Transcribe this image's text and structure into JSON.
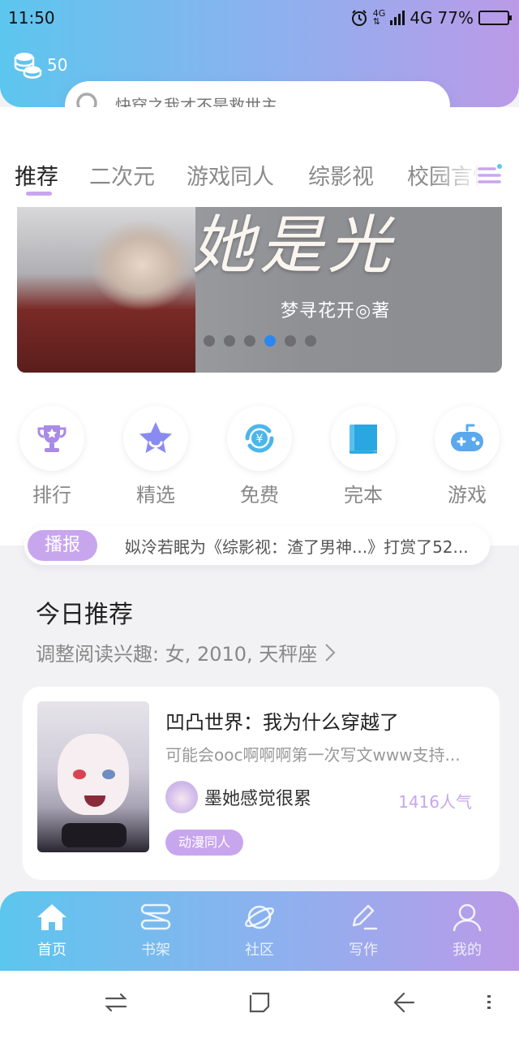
{
  "status_bar": {
    "time": "11:50",
    "network_small_top": "4G",
    "network_small_bottom": "⇅",
    "network": "4G",
    "battery": "77%",
    "battery_level": 0.77
  },
  "header": {
    "coin_count": "50",
    "search_placeholder": "快穿之我才不是救世主"
  },
  "tabs": [
    {
      "label": "推荐",
      "active": true
    },
    {
      "label": "二次元"
    },
    {
      "label": "游戏同人"
    },
    {
      "label": "综影视"
    },
    {
      "label": "校园言情"
    }
  ],
  "banner": {
    "title": "她是光",
    "author": "梦寻花开◎著",
    "dots_count": 6,
    "active_dot": 3
  },
  "categories": [
    {
      "label": "排行",
      "icon": "trophy-icon"
    },
    {
      "label": "精选",
      "icon": "star-icon"
    },
    {
      "label": "免费",
      "icon": "yen-coin-icon"
    },
    {
      "label": "完本",
      "icon": "book-icon"
    },
    {
      "label": "游戏",
      "icon": "gamepad-icon"
    }
  ],
  "broadcast": {
    "badge": "播报",
    "message": "姒泠若眠为《综影视：渣了男神...》打赏了52..."
  },
  "recommend": {
    "title": "今日推荐",
    "subtitle": "调整阅读兴趣: 女, 2010, 天秤座",
    "book": {
      "title": "凹凸世界：我为什么穿越了",
      "description": "可能会ooc啊啊啊第一次写文www支持...",
      "author": "墨她感觉很累",
      "popularity": "1416人气",
      "tag": "动漫同人"
    }
  },
  "bottom_nav": [
    {
      "label": "首页",
      "icon": "home-icon",
      "active": true
    },
    {
      "label": "书架",
      "icon": "bookshelf-icon"
    },
    {
      "label": "社区",
      "icon": "planet-icon"
    },
    {
      "label": "写作",
      "icon": "pen-icon"
    },
    {
      "label": "我的",
      "icon": "user-icon"
    }
  ],
  "colors": {
    "accent": "#c8a6ee",
    "header_start": "#5cc6ee",
    "header_end": "#bb9ae8",
    "active_dot": "#2d86f0"
  }
}
